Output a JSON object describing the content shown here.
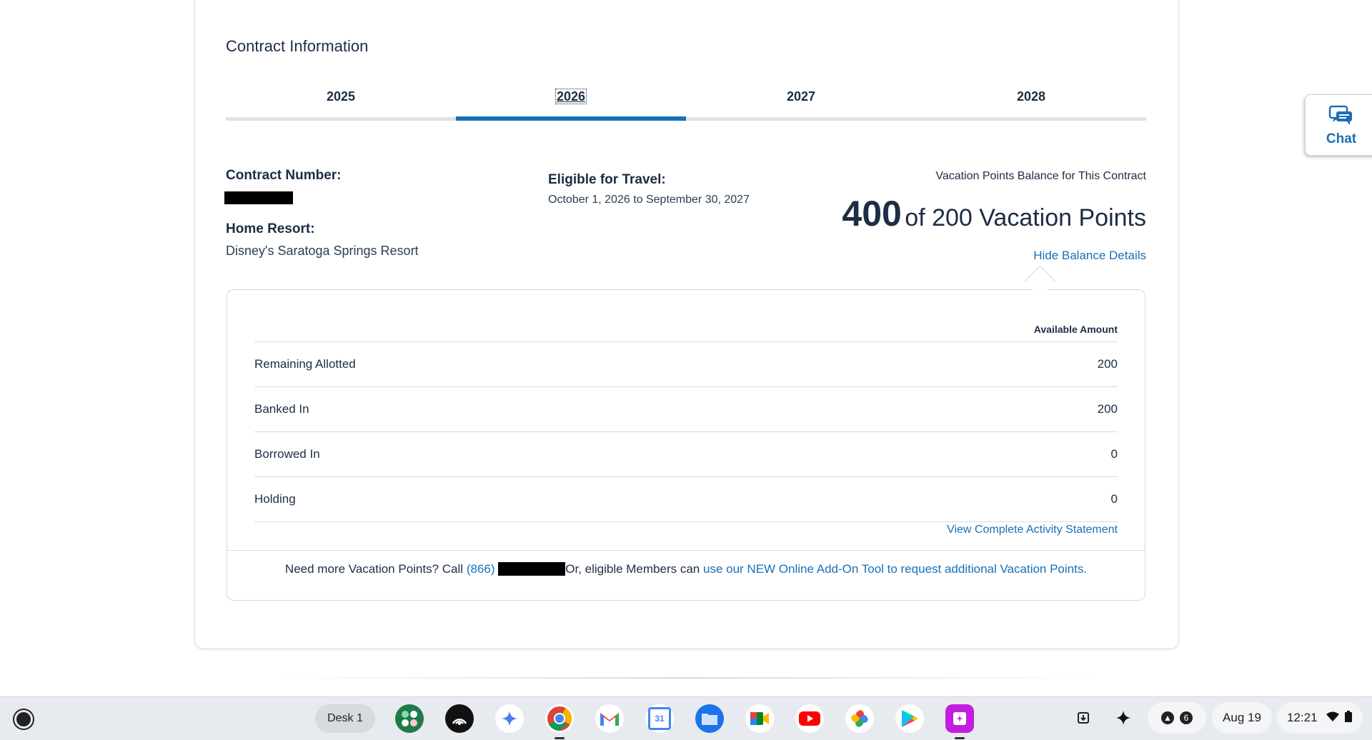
{
  "section_title": "Contract Information",
  "tabs": [
    {
      "label": "2025"
    },
    {
      "label": "2026"
    },
    {
      "label": "2027"
    },
    {
      "label": "2028"
    }
  ],
  "active_tab_index": 1,
  "contract": {
    "number_label": "Contract Number:",
    "home_resort_label": "Home Resort:",
    "home_resort_value": "Disney's Saratoga Springs Resort",
    "eligible_label": "Eligible for Travel:",
    "eligible_value": "October 1, 2026 to September 30, 2027"
  },
  "balance": {
    "heading": "Vacation Points Balance for This Contract",
    "current": "400",
    "of_text": "of 200 Vacation Points",
    "hide_link": "Hide Balance Details"
  },
  "details": {
    "column_header": "Available Amount",
    "rows": [
      {
        "label": "Remaining Allotted",
        "value": "200"
      },
      {
        "label": "Banked In",
        "value": "200"
      },
      {
        "label": "Borrowed In",
        "value": "0"
      },
      {
        "label": "Holding",
        "value": "0"
      }
    ],
    "activity_link": "View Complete Activity Statement",
    "footer_prefix": "Need more Vacation Points? Call",
    "footer_phone": "(866)",
    "footer_middle": "Or, eligible Members can",
    "footer_link": "use our NEW Online Add-On Tool to request additional Vacation Points."
  },
  "chat": {
    "label": "Chat",
    "icon": "chat-bubbles-icon",
    "color": "#1a6fb5"
  },
  "accent_color": "#1a6fb5",
  "shelf": {
    "desk_label": "Desk 1",
    "apps": [
      "launcher-apps-icon",
      "podcast-icon",
      "gemini-icon",
      "chrome-icon",
      "gmail-icon",
      "calendar-icon",
      "files-icon",
      "meet-icon",
      "youtube-icon",
      "photos-icon",
      "play-store-icon",
      "canvas-icon"
    ],
    "calendar_day": "31",
    "notification_count": "6",
    "date": "Aug 19",
    "time": "12:21"
  }
}
